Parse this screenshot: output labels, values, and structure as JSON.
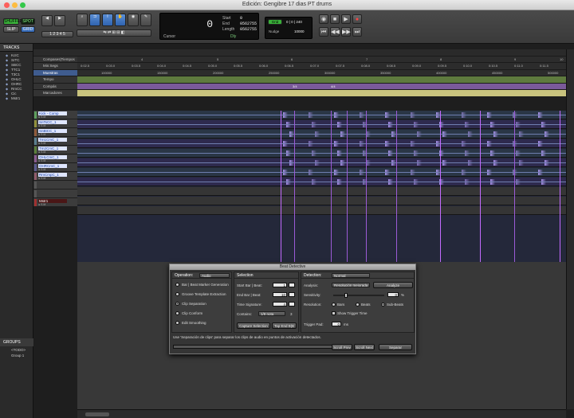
{
  "window": {
    "title": "Edición: Gengibre 17 dias PT drums"
  },
  "toolbar": {
    "mode_shuffle": "SHUFFLE",
    "mode_spot": "SPOT",
    "mode_slip": "SLIP",
    "mode_grid": "GRID",
    "counter_main": "0",
    "start_label": "Start",
    "start_value": "0",
    "end_label": "End",
    "end_value": "0562755",
    "length_label": "Length",
    "length_value": "0562755",
    "cursor_label": "Cursor",
    "dly_label": "Dly",
    "grid_label": "Grid",
    "grid_value": "0 | 0 | 240",
    "nudge_label": "Nudge",
    "nudge_value": "10000"
  },
  "left_panel": {
    "tracks_title": "TRACKS",
    "tracks": [
      "KcIC",
      "SrTC",
      "SBCC",
      "TTC1",
      "T3C1",
      "OHLC",
      "OHRC",
      "RmCC",
      "Cic",
      "Mstr1"
    ],
    "groups_title": "GROUPS",
    "groups": [
      "<TODO>",
      "Group 1"
    ]
  },
  "rulers": {
    "labels": [
      "Compases|Tiempos",
      "Min:Segs",
      "Muestras",
      "Tempo",
      "Compás",
      "Marcadores"
    ],
    "bars": [
      "2",
      "3",
      "4",
      "5",
      "6",
      "7",
      "8",
      "9",
      "10"
    ],
    "minsecs": [
      "0:02.5",
      "0:03.0",
      "0:03.5",
      "0:04.0",
      "0:04.5",
      "0:05.0",
      "0:05.5",
      "0:06.0",
      "0:06.5",
      "0:07.0",
      "0:07.5",
      "0:08.0",
      "0:08.5",
      "0:09.0",
      "0:09.5",
      "0:10.0",
      "0:10.5",
      "0:11.0",
      "0:11.5"
    ],
    "samples": [
      "100000",
      "150000",
      "200000",
      "250000",
      "300000",
      "350000",
      "400000",
      "450000",
      "500000"
    ],
    "meter_marks": [
      "3/4",
      "4/4"
    ]
  },
  "track_list": [
    {
      "name": "Kick - Comp",
      "color": "#5c9e5c"
    },
    {
      "name": "SnTsCC_1",
      "color": "#8f8f3a"
    },
    {
      "name": "SnBtCC_1",
      "color": "#8f5a3a"
    },
    {
      "name": "Tm1CmC_1",
      "color": "#5a7f8f"
    },
    {
      "name": "Tm2CmC_1",
      "color": "#5a7f3a"
    },
    {
      "name": "OHLCmC_1",
      "color": "#8a5a8f"
    },
    {
      "name": "OHRCmC_1",
      "color": "#5a5a8f"
    },
    {
      "name": "RmCmpC_1",
      "color": "#8f5a6a"
    },
    {
      "name": "",
      "color": "#555"
    },
    {
      "name": "",
      "color": "#555"
    },
    {
      "name": "Mstr1",
      "color": "#a03030"
    }
  ],
  "track_buttons": "● S M",
  "dialog": {
    "title": "Beat Detective",
    "operation_header": "Operation:",
    "operation_value": "Audio",
    "operations": [
      {
        "label": "Bar | Beat Marker Generation",
        "selected": false
      },
      {
        "label": "Groove Template Extraction",
        "selected": false
      },
      {
        "label": "Clip Separation",
        "selected": true
      },
      {
        "label": "Clip Conform",
        "selected": false
      },
      {
        "label": "Edit Smoothing",
        "selected": false
      }
    ],
    "selection_header": "Selection",
    "start_bar_label": "Start Bar | Beat:",
    "start_bar_value": "1",
    "end_bar_label": "End Bar | Beat:",
    "end_bar_value": "10",
    "time_sig_label": "Time Signature:",
    "time_sig_value": "4",
    "contains_label": "Contains:",
    "contains_value": "1/8 nota",
    "contains_extra": "3",
    "capture_btn": "Capture Selection",
    "tap_btn": "Tap End B|B",
    "detection_header": "Detection:",
    "detection_value": "Normal",
    "analysis_label": "Analysis:",
    "analysis_value": "Resolución mejorada",
    "analyze_btn": "Analyze",
    "sensitivity_label": "Sensitivity:",
    "sensitivity_value": "0",
    "sensitivity_unit": "%",
    "resolution_label": "Resolution:",
    "res_bars": "Bars",
    "res_beats": "Beats",
    "res_subbeats": "Sub-Beats",
    "show_trigger": "Show Trigger Time",
    "trigger_pad_label": "Trigger Pad:",
    "trigger_pad_value": "0",
    "trigger_pad_unit": "ms",
    "status": "Use 'Separación de clips' para separar los clips de audio en puntos de activación detectados.",
    "scroll_prev": "Scroll Prev",
    "scroll_next": "Scroll Next",
    "separate": "Separar"
  }
}
